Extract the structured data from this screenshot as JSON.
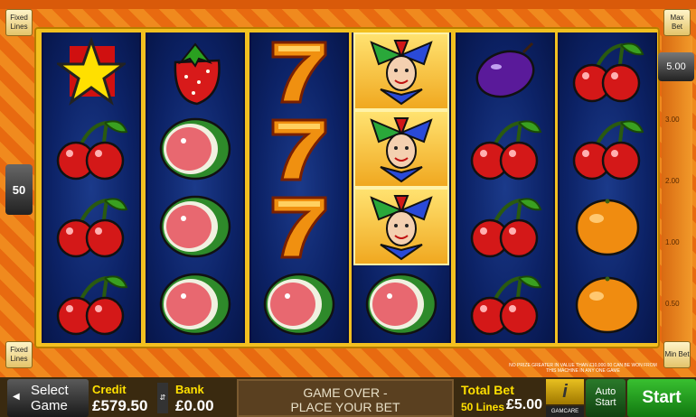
{
  "side_buttons": {
    "fixed_lines_top": "Fixed Lines",
    "fixed_lines_bottom": "Fixed Lines",
    "max_bet": "Max Bet",
    "min_bet": "Min Bet",
    "lines_value": "50"
  },
  "bet_scale": {
    "current": "5.00",
    "ticks": [
      "3.00",
      "2.00",
      "1.00",
      "0.50"
    ]
  },
  "reels": [
    [
      "star",
      "cherry",
      "cherry",
      "cherry"
    ],
    [
      "strawberry",
      "melon",
      "melon",
      "melon"
    ],
    [
      "seven",
      "seven",
      "seven",
      "melon"
    ],
    [
      "joker",
      "joker",
      "joker",
      "melon"
    ],
    [
      "plum",
      "cherry",
      "cherry",
      "cherry"
    ],
    [
      "cherry",
      "cherry",
      "orange",
      "orange"
    ]
  ],
  "highlighted": [
    [
      3,
      0
    ],
    [
      3,
      1
    ],
    [
      3,
      2
    ]
  ],
  "disclaimer": "NO PRIZE GREATER IN VALUE THAN £10,000.00 CAN BE WON FROM THIS MACHINE IN ANY ONE GAME",
  "bottom": {
    "select_game": "Select Game",
    "credit_label": "Credit",
    "credit_value": "£579.50",
    "bank_label": "Bank",
    "bank_value": "£0.00",
    "message_line1": "GAME OVER -",
    "message_line2": "PLACE YOUR BET",
    "total_bet_label": "Total Bet",
    "lines_text": "50 Lines",
    "total_bet_value": "£5.00",
    "info": "i",
    "gamcare": "GAMCARE",
    "auto_start": "Auto Start",
    "start": "Start"
  }
}
